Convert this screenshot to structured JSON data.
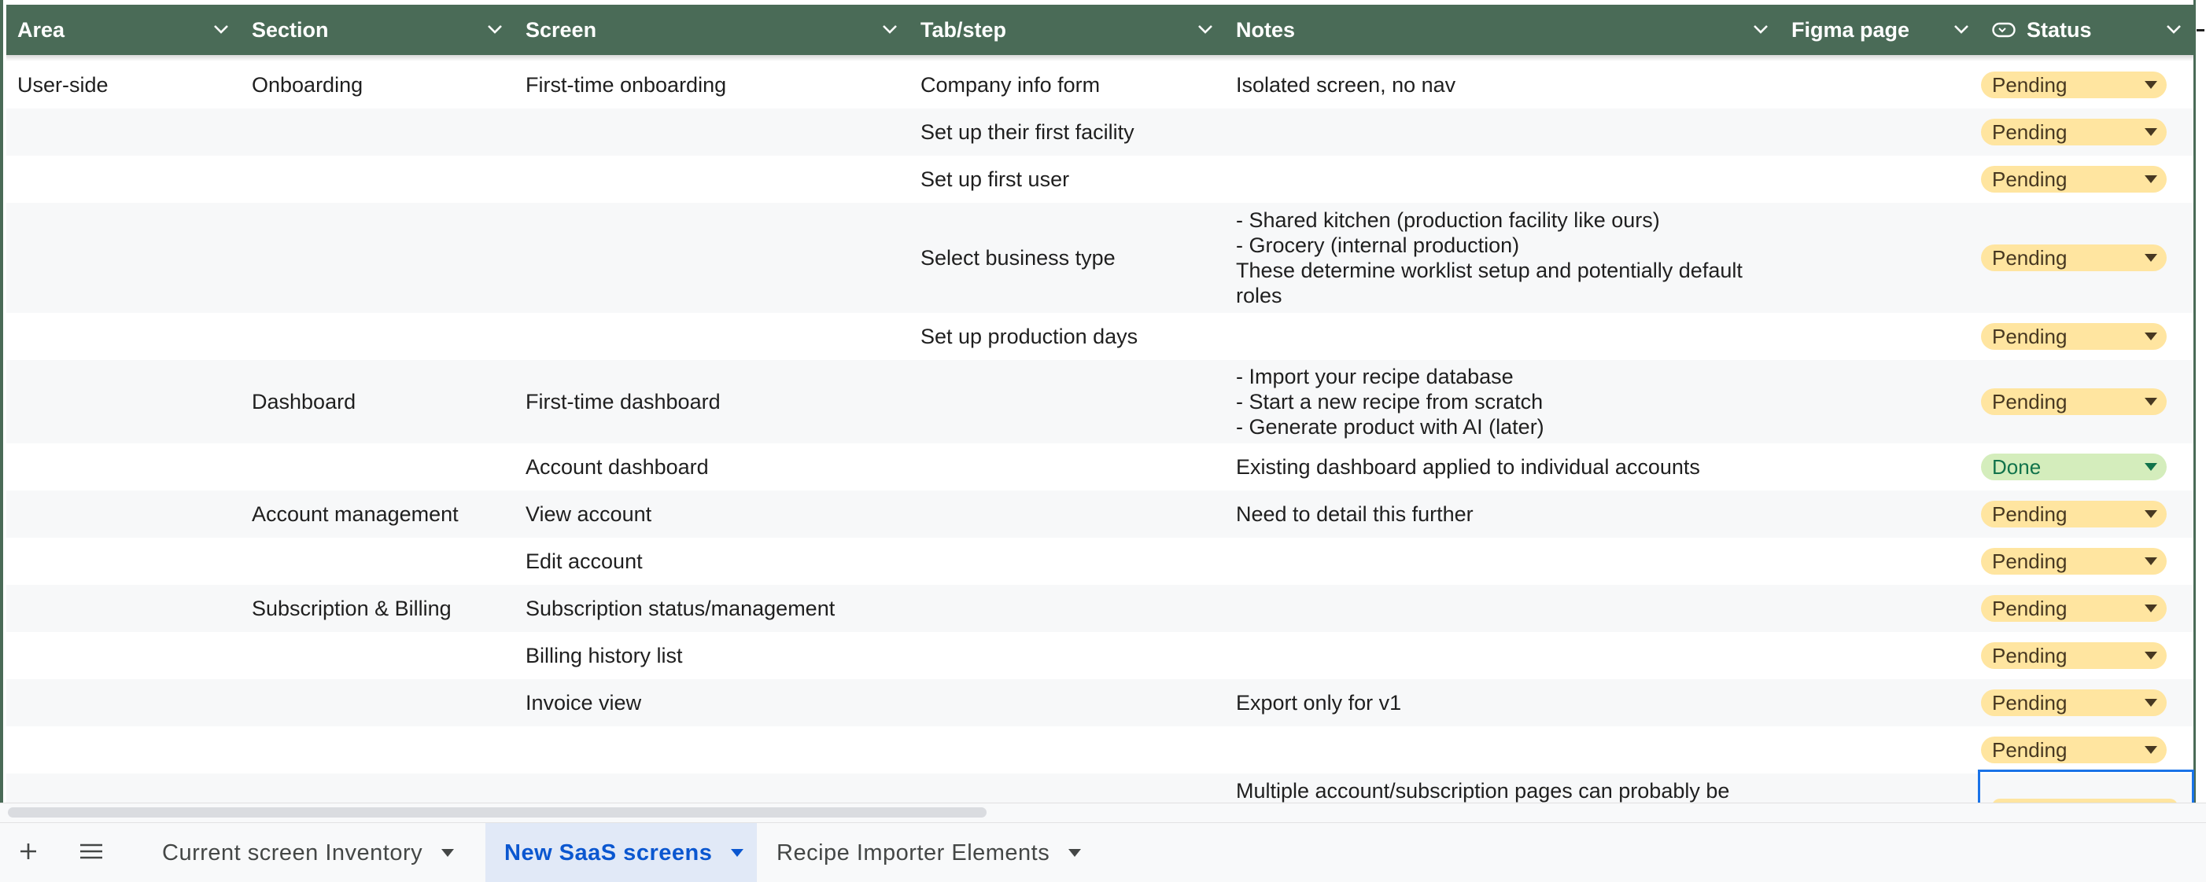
{
  "columns": {
    "area": "Area",
    "section": "Section",
    "screen": "Screen",
    "tab_step": "Tab/step",
    "notes": "Notes",
    "figma_page": "Figma page",
    "status": "Status"
  },
  "rows": [
    {
      "area": "User-side",
      "section": "Onboarding",
      "screen": "First-time onboarding",
      "tab": "Company info form",
      "notes": "Isolated screen, no nav",
      "figma": "",
      "status": "Pending"
    },
    {
      "area": "",
      "section": "",
      "screen": "",
      "tab": "Set up their first facility",
      "notes": "",
      "figma": "",
      "status": "Pending"
    },
    {
      "area": "",
      "section": "",
      "screen": "",
      "tab": "Set up first user",
      "notes": "",
      "figma": "",
      "status": "Pending"
    },
    {
      "area": "",
      "section": "",
      "screen": "",
      "tab": "Select  business type",
      "notes": "- Shared kitchen (production facility like ours)\n- Grocery (internal production)\nThese determine worklist setup and potentially default\nroles",
      "figma": "",
      "status": "Pending"
    },
    {
      "area": "",
      "section": "",
      "screen": "",
      "tab": "Set up production days",
      "notes": "",
      "figma": "",
      "status": "Pending"
    },
    {
      "area": "",
      "section": "Dashboard",
      "screen": "First-time dashboard",
      "tab": "",
      "notes": "- Import your recipe database\n- Start a new recipe from scratch\n- Generate product with AI (later)",
      "figma": "",
      "status": "Pending"
    },
    {
      "area": "",
      "section": "",
      "screen": "Account dashboard",
      "tab": "",
      "notes": "Existing dashboard applied to individual accounts",
      "figma": "",
      "status": "Done"
    },
    {
      "area": "",
      "section": "Account management",
      "screen": "View account",
      "tab": "",
      "notes": "Need to detail this further",
      "figma": "",
      "status": "Pending"
    },
    {
      "area": "",
      "section": "",
      "screen": "Edit account",
      "tab": "",
      "notes": "",
      "figma": "",
      "status": "Pending"
    },
    {
      "area": "",
      "section": "Subscription & Billing",
      "screen": "Subscription status/management",
      "tab": "",
      "notes": "",
      "figma": "",
      "status": "Pending"
    },
    {
      "area": "",
      "section": "",
      "screen": "Billing history list",
      "tab": "",
      "notes": "",
      "figma": "",
      "status": "Pending"
    },
    {
      "area": "",
      "section": "",
      "screen": "Invoice view",
      "tab": "",
      "notes": "Export only for v1",
      "figma": "",
      "status": "Pending"
    },
    {
      "area": "",
      "section": "",
      "screen": "",
      "tab": "",
      "notes": "",
      "figma": "",
      "status": "Pending"
    },
    {
      "area": "",
      "section": "",
      "screen": "",
      "tab": "",
      "notes": "Multiple account/subscription pages can probably be",
      "figma": "",
      "status": ""
    }
  ],
  "sheet_tabs": [
    {
      "label": "Current screen Inventory",
      "active": false
    },
    {
      "label": "New SaaS screens",
      "active": true
    },
    {
      "label": "Recipe Importer Elements",
      "active": false
    }
  ],
  "colors": {
    "header_bg": "#4a6b57",
    "pending_chip": "#ffe5a0",
    "done_chip": "#d4edbc",
    "active_tab": "#0b57d0"
  },
  "icons": {
    "add_sheet": "plus-icon",
    "all_sheets": "menu-icon",
    "column_filter": "chevron-down-icon",
    "status_column": "dropdown-chip-icon"
  }
}
